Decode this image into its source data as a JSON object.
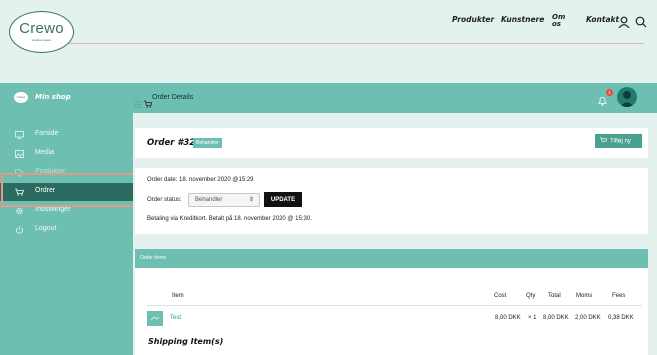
{
  "site": {
    "logo_text": "Crewo",
    "logo_tagline": "creative space",
    "nav": {
      "products": "Produkter",
      "artists": "Kunstnere",
      "about_line1": "Om",
      "about_line2": "os",
      "contact": "Kontakt"
    }
  },
  "appbar": {
    "shop_logo": "Crewo",
    "shop_name": "Min shop",
    "breadcrumb": "Order Details",
    "notification_count": "1"
  },
  "sidebar": {
    "items": [
      {
        "label": "Forside",
        "icon": "monitor-icon"
      },
      {
        "label": "Media",
        "icon": "image-icon"
      },
      {
        "label": "Produkter",
        "icon": "tag-icon"
      },
      {
        "label": "Ordrer",
        "icon": "cart-icon",
        "active": true
      },
      {
        "label": "Indstillinger",
        "icon": "gear-icon"
      },
      {
        "label": "Logout",
        "icon": "power-icon"
      }
    ]
  },
  "order": {
    "title": "Order #3297",
    "status_badge": "Behandler",
    "add_new": "Tilføj ny",
    "date_text": "Order date: 18. november 2020 @15:29",
    "status_label": "Order status:",
    "status_value": "Behandler",
    "update_label": "UPDATE",
    "payment_text": "Betaling via Kreditkort. Betalt på 18. november 2020 @ 15:30."
  },
  "items": {
    "section_title": "Order items",
    "columns": {
      "item": "Item",
      "cost": "Cost",
      "qty": "Qty",
      "total": "Total",
      "moms": "Moms",
      "fees": "Fees"
    },
    "rows": [
      {
        "name": "Test",
        "cost": "8,00 DKK",
        "qty": "× 1",
        "total": "8,00 DKK",
        "moms": "2,00 DKK",
        "fees": "0,38 DKK"
      }
    ],
    "shipping_title": "Shipping Item(s)"
  },
  "colors": {
    "teal": "#6dc0b1",
    "dark_teal": "#2b6b5f",
    "highlight": "#e59a87"
  }
}
